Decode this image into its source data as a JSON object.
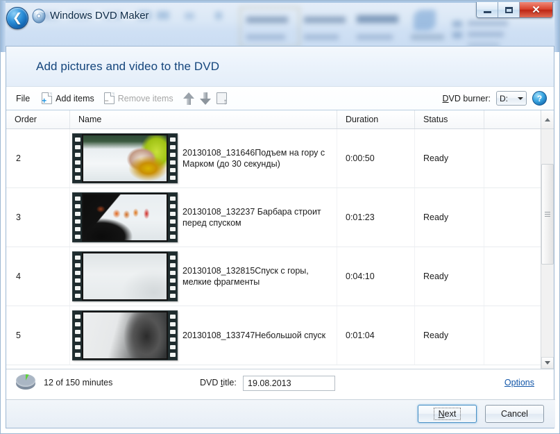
{
  "window": {
    "title": "Windows DVD Maker",
    "app_icon": "dvd-disc-icon",
    "back_button_icon": "back-arrow-icon",
    "controls": {
      "minimize": "minimize-icon",
      "maximize": "maximize-icon",
      "close": "✕"
    }
  },
  "header": {
    "heading": "Add pictures and video to the DVD"
  },
  "toolbar": {
    "file_label": "File",
    "add_items_label": "Add items",
    "remove_items_label": "Remove items",
    "move_up_icon": "arrow-up-icon",
    "move_down_icon": "arrow-down-icon",
    "properties_icon": "page-up-icon",
    "burner_label": "DVD burner:",
    "burner_label_prefix": "D",
    "burner_label_rest": "VD burner:",
    "burner_value": "D:",
    "help_label": "?"
  },
  "list": {
    "columns": [
      "Order",
      "Name",
      "Duration",
      "Status",
      ""
    ],
    "rows": [
      {
        "order": "2",
        "name": "20130108_131646Подъем на гору с Марком (до 30 секунды)",
        "duration": "0:00:50",
        "status": "Ready",
        "thumb": "ski-closeup-thumbnail"
      },
      {
        "order": "3",
        "name": "20130108_132237 Барбара строит перед спуском",
        "duration": "0:01:23",
        "status": "Ready",
        "thumb": "group-on-slope-thumbnail"
      },
      {
        "order": "4",
        "name": "20130108_132815Спуск с горы, мелкие фрагменты",
        "duration": "0:04:10",
        "status": "Ready",
        "thumb": "white-snow-thumbnail"
      },
      {
        "order": "5",
        "name": "20130108_133747Небольшой спуск",
        "duration": "0:01:04",
        "status": "Ready",
        "thumb": "dark-blur-thumbnail"
      }
    ]
  },
  "status": {
    "capacity_text": "12 of 150 minutes",
    "capacity_used_minutes": 12,
    "capacity_total_minutes": 150,
    "dvd_title_label": "DVD title:",
    "dvd_title_label_pre": "DVD ",
    "dvd_title_label_key": "t",
    "dvd_title_label_post": "itle:",
    "dvd_title_value": "19.08.2013",
    "options_link": "Options"
  },
  "footer": {
    "next_label": "Next",
    "next_key": "N",
    "next_rest": "ext",
    "cancel_label": "Cancel"
  },
  "colors": {
    "accent": "#14457c",
    "link": "#1155a8",
    "close_button": "#bd2513",
    "capacity_used": "#5fcf3d"
  }
}
